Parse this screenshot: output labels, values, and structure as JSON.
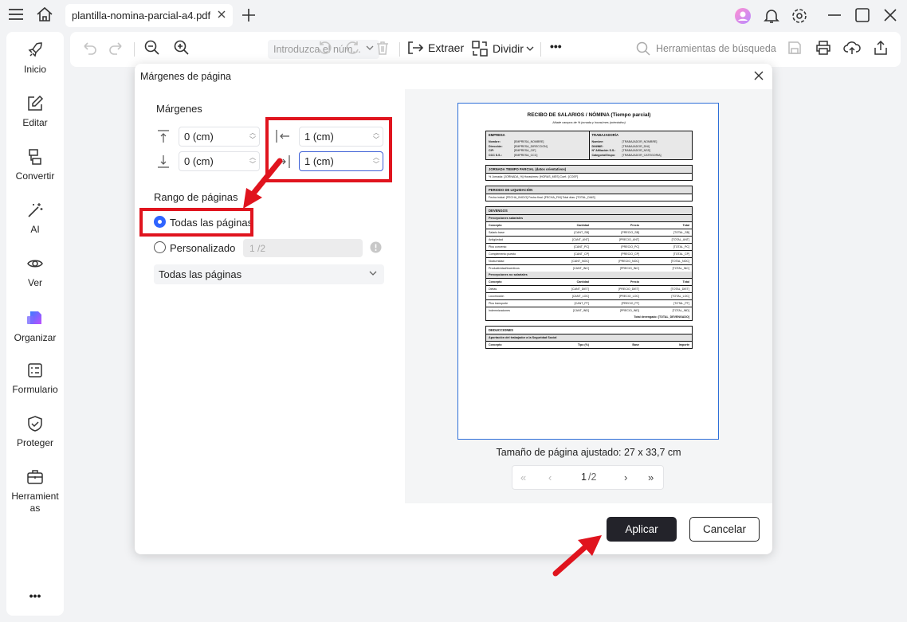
{
  "tab": {
    "title": "plantilla-nomina-parcial-a4.pdf"
  },
  "sidebar": {
    "items": [
      {
        "label": "Inicio",
        "icon": "rocket-icon"
      },
      {
        "label": "Editar",
        "icon": "edit-icon"
      },
      {
        "label": "Convertir",
        "icon": "convert-icon"
      },
      {
        "label": "AI",
        "icon": "ai-wand-icon"
      },
      {
        "label": "Ver",
        "icon": "eye-icon"
      },
      {
        "label": "Organizar",
        "icon": "organize-icon"
      },
      {
        "label": "Formulario",
        "icon": "form-icon"
      },
      {
        "label": "Proteger",
        "icon": "shield-icon"
      },
      {
        "label": "Herramientas",
        "icon": "toolbox-icon"
      }
    ],
    "more": "•••"
  },
  "toolbar": {
    "page_placeholder": "Introduzca el núm...",
    "extract_label": "Extraer",
    "split_label": "Dividir",
    "more": "•••",
    "search_label": "Herramientas de búsqueda"
  },
  "dialog": {
    "title": "Márgenes de página",
    "margins_heading": "Márgenes",
    "margin_top": "0 (cm)",
    "margin_bottom": "0 (cm)",
    "margin_left": "1 (cm)",
    "margin_right": "1 (cm)",
    "range_heading": "Rango de páginas",
    "option_all": "Todas las páginas",
    "option_custom": "Personalizado",
    "custom_placeholder": "1 /2",
    "select_value": "Todas las páginas",
    "page_size_label": "Tamaño de página ajustado: 27 x 33,7 cm",
    "pager": {
      "current": "1",
      "total": "/2"
    },
    "apply_label": "Aplicar",
    "cancel_label": "Cancelar",
    "accent_color": "#2f64ff",
    "highlight_color": "#e0141e"
  },
  "preview_doc": {
    "title": "RECIBO DE SALARIOS / NÓMINA (Tiempo parcial)",
    "subtitle": "Añade campos de % jornada y horas/mes (orientativo)",
    "empresa": {
      "heading": "EMPRESA",
      "rows": [
        [
          "Nombre:",
          "[EMPRESA_NOMBRE]"
        ],
        [
          "Dirección:",
          "[EMPRESA_DIRECCION]"
        ],
        [
          "CIF:",
          "[EMPRESA_CIF]"
        ],
        [
          "CCC S.S.:",
          "[EMPRESA_CCC]"
        ]
      ]
    },
    "trabajador": {
      "heading": "TRABAJADOR/A",
      "rows": [
        [
          "Nombre:",
          "[TRABAJADOR_NOMBRE]"
        ],
        [
          "DNI/NIE:",
          "[TRABAJADOR_DNI]"
        ],
        [
          "Nº Afiliación S.S.:",
          "[TRABAJADOR_NSS]"
        ],
        [
          "Categoría/Grupo:",
          "[TRABAJADOR_CATEGORIA]"
        ]
      ]
    },
    "jornada": {
      "heading": "JORNADA TIEMPO PARCIAL (datos orientativos)",
      "text": "% Jornada: [JORNADA_%]   Horas/mes: [HORAS_MES]   Coef.: [COEF]"
    },
    "periodo": {
      "heading": "PERIODO DE LIQUIDACIÓN",
      "text": "Fecha inicial: [FECHA_INICIO]   Fecha final: [FECHA_FIN]   Total días: [TOTAL_DIAS]"
    },
    "devengos": {
      "heading": "DEVENGOS",
      "salariales_heading": "Percepciones salariales",
      "cols": [
        "Concepto",
        "Cantidad",
        "Precio",
        "Total"
      ],
      "salariales": [
        [
          "Salario base",
          "[CANT_SB]",
          "[PRECIO_SB]",
          "[TOTAL_SB]"
        ],
        [
          "Antigüedad",
          "[CANT_ANT]",
          "[PRECIO_ANT]",
          "[TOTAL_ANT]"
        ],
        [
          "Plus convenio",
          "[CANT_PC]",
          "[PRECIO_PC]",
          "[TOTAL_PC]"
        ],
        [
          "Complemento puesto",
          "[CANT_CP]",
          "[PRECIO_CP]",
          "[TOTAL_CP]"
        ],
        [
          "Nocturnidad",
          "[CANT_NOC]",
          "[PRECIO_NOC]",
          "[TOTAL_NOC]"
        ],
        [
          "Productividad/incentivos",
          "[CANT_INC]",
          "[PRECIO_INC]",
          "[TOTAL_INC]"
        ]
      ],
      "no_salariales_heading": "Percepciones no salariales",
      "no_salariales": [
        [
          "Dietas",
          "[CANT_DIET]",
          "[PRECIO_DIET]",
          "[TOTAL_DIET]"
        ],
        [
          "Locomoción",
          "[CANT_LOC]",
          "[PRECIO_LOC]",
          "[TOTAL_LOC]"
        ],
        [
          "Plus transporte",
          "[CANT_PT]",
          "[PRECIO_PT]",
          "[TOTAL_PT]"
        ],
        [
          "Indemnizaciones",
          "[CANT_IND]",
          "[PRECIO_IND]",
          "[TOTAL_IND]"
        ]
      ],
      "total": "Total devengado: [TOTAL_DEVENGADO]"
    },
    "deducciones": {
      "heading": "DEDUCCIONES",
      "sub": "Aportación del trabajador a la Seguridad Social",
      "cols": [
        "Concepto",
        "Tipo (%)",
        "Base",
        "Importe"
      ]
    }
  }
}
